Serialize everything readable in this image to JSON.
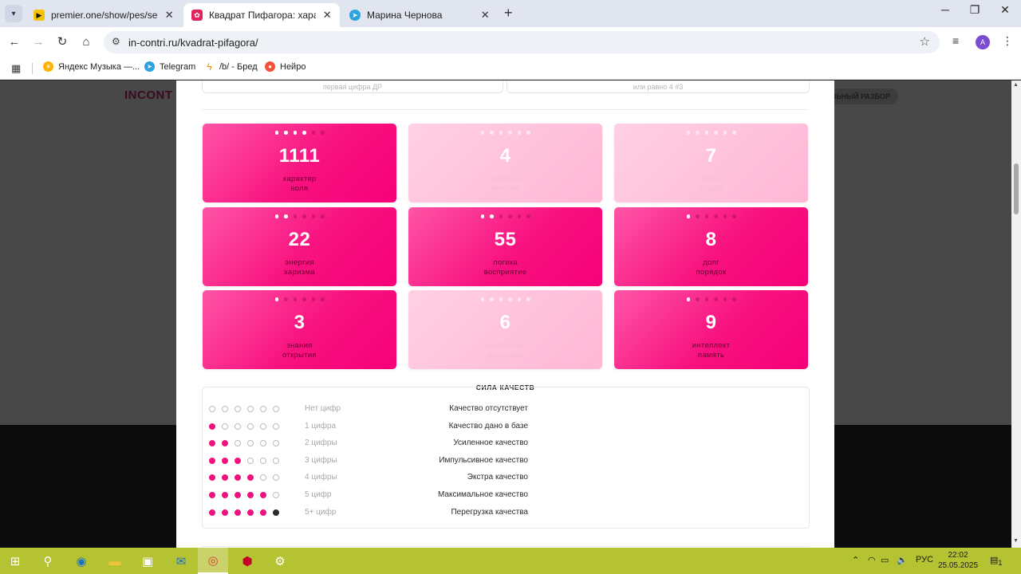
{
  "browser": {
    "tabs": [
      {
        "title": "premier.one/show/pes/season/",
        "active": false,
        "favicon_color": "#f5c400"
      },
      {
        "title": "Квадрат Пифагора: характер, с",
        "active": true,
        "favicon_color": "#e0245e"
      },
      {
        "title": "Марина Чернова",
        "active": false,
        "favicon_color": "#2aa3e0"
      }
    ],
    "url": "in-contri.ru/kvadrat-pifagora/",
    "profile_initial": "А",
    "bookmarks": [
      "Яндекс Музыка —...",
      "Telegram",
      "/b/ - Бред",
      "Нейро"
    ]
  },
  "background_site": {
    "logo": "INCONT",
    "button": "ЛЬНЫЙ РАЗБОР"
  },
  "modal": {
    "prev_cards": [
      "первая цифра ДР",
      "или равно 4 #3"
    ],
    "cards": [
      {
        "number": "1111",
        "label1": "характер",
        "label2": "воля",
        "filled": 4,
        "active": true
      },
      {
        "number": "4",
        "label1": "здоровье",
        "label2": "красота",
        "filled": 0,
        "active": false
      },
      {
        "number": "7",
        "label1": "удача",
        "label2": "судьба",
        "filled": 0,
        "active": false
      },
      {
        "number": "22",
        "label1": "энергия",
        "label2": "харизма",
        "filled": 2,
        "active": true
      },
      {
        "number": "55",
        "label1": "логика",
        "label2": "восприятие",
        "filled": 2,
        "active": true
      },
      {
        "number": "8",
        "label1": "долг",
        "label2": "порядок",
        "filled": 1,
        "active": true
      },
      {
        "number": "3",
        "label1": "знания",
        "label2": "открытия",
        "filled": 1,
        "active": true
      },
      {
        "number": "6",
        "label1": "мастерство",
        "label2": "искусство",
        "filled": 0,
        "active": false
      },
      {
        "number": "9",
        "label1": "интеллект",
        "label2": "память",
        "filled": 1,
        "active": true
      }
    ],
    "legend": {
      "title": "СИЛА КАЧЕСТВ",
      "rows": [
        {
          "count": "Нет цифр",
          "description": "Качество отсутствует",
          "pink": 0,
          "dark": 0
        },
        {
          "count": "1 цифра",
          "description": "Качество дано в базе",
          "pink": 1,
          "dark": 0
        },
        {
          "count": "2 цифры",
          "description": "Усиленное качество",
          "pink": 2,
          "dark": 0
        },
        {
          "count": "3 цифры",
          "description": "Импульсивное качество",
          "pink": 3,
          "dark": 0
        },
        {
          "count": "4 цифры",
          "description": "Экстра качество",
          "pink": 4,
          "dark": 0
        },
        {
          "count": "5 цифр",
          "description": "Максимальное качество",
          "pink": 5,
          "dark": 0
        },
        {
          "count": "5+ цифр",
          "description": "Перегрузка качества",
          "pink": 5,
          "dark": 1
        }
      ]
    }
  },
  "taskbar": {
    "language": "РУС",
    "time": "22:02",
    "date": "25.05.2025",
    "notifications": "1"
  }
}
